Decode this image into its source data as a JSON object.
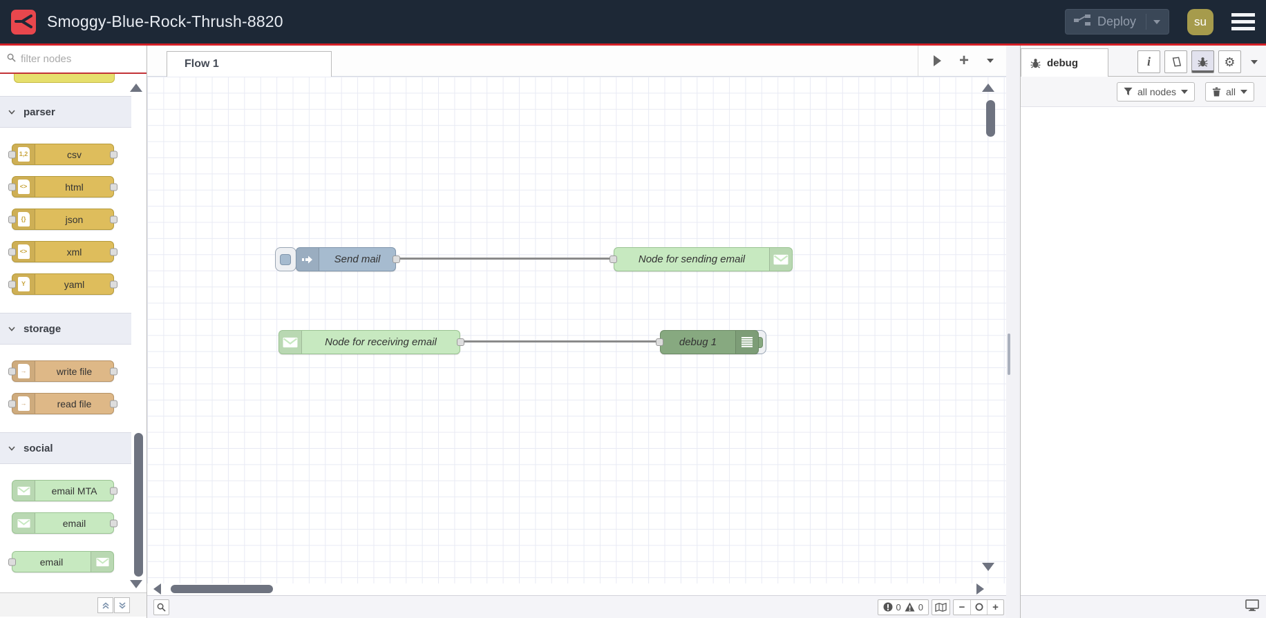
{
  "header": {
    "title": "Smoggy-Blue-Rock-Thrush-8820",
    "deploy_label": "Deploy",
    "avatar_text": "su"
  },
  "palette": {
    "filter_placeholder": "filter nodes",
    "categories": [
      {
        "label": "parser",
        "nodes": [
          {
            "label": "csv",
            "icon": "file-numbers-icon",
            "icon_mark": "1,2",
            "color": "#debd5c",
            "ports": "both"
          },
          {
            "label": "html",
            "icon": "file-code-icon",
            "icon_mark": "<>",
            "color": "#debd5c",
            "ports": "both"
          },
          {
            "label": "json",
            "icon": "file-braces-icon",
            "icon_mark": "{}",
            "color": "#debd5c",
            "ports": "both"
          },
          {
            "label": "xml",
            "icon": "file-code-icon",
            "icon_mark": "<>",
            "color": "#debd5c",
            "ports": "both"
          },
          {
            "label": "yaml",
            "icon": "file-yaml-icon",
            "icon_mark": "Y",
            "color": "#debd5c",
            "ports": "both"
          }
        ]
      },
      {
        "label": "storage",
        "nodes": [
          {
            "label": "write file",
            "icon": "file-import-icon",
            "icon_mark": "→",
            "color": "#deb887",
            "ports": "both"
          },
          {
            "label": "read file",
            "icon": "file-export-icon",
            "icon_mark": "→",
            "color": "#deb887",
            "ports": "both"
          }
        ]
      },
      {
        "label": "social",
        "nodes": [
          {
            "label": "email MTA",
            "icon": "envelope-icon",
            "color": "#c7e9c0",
            "ports": "right"
          },
          {
            "label": "email",
            "icon": "envelope-icon",
            "color": "#c7e9c0",
            "ports": "right"
          },
          {
            "label": "email",
            "icon": "envelope-icon",
            "color": "#c7e9c0",
            "ports": "left"
          }
        ]
      }
    ]
  },
  "workspace": {
    "tab_label": "Flow 1",
    "nodes": [
      {
        "label": "Send mail",
        "type": "inject",
        "color": "#a6bbcf"
      },
      {
        "label": "Node for sending email",
        "type": "email-out",
        "color": "#c7e9c0"
      },
      {
        "label": "Node for receiving email",
        "type": "email-in",
        "color": "#c7e9c0"
      },
      {
        "label": "debug 1",
        "type": "debug",
        "color": "#87a980"
      }
    ],
    "footer": {
      "error_count": "0",
      "warning_count": "0"
    }
  },
  "sidebar": {
    "tab_label": "debug",
    "filter_label": "all nodes",
    "clear_label": "all"
  },
  "icons": {
    "plus": "+",
    "minus": "−",
    "gear": "⚙",
    "info": "i"
  },
  "colors": {
    "header_bg": "#1d2836",
    "accent_red": "#d41f26",
    "logo_red": "#e8474d",
    "avatar_bg": "#a69b4c",
    "inject_node": "#a6bbcf",
    "email_node": "#c7e9c0",
    "debug_node": "#87a980",
    "parser_node": "#debd5c",
    "storage_node": "#deb887",
    "partial_node_yellow": "#e6df6d",
    "wire": "#8a8a8a"
  }
}
